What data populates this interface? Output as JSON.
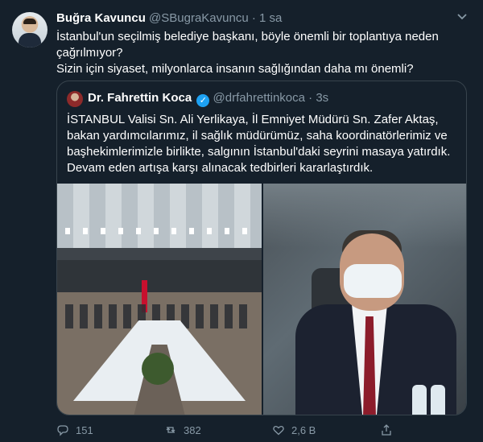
{
  "tweet": {
    "author_name": "Buğra Kavuncu",
    "handle": "@SBugraKavuncu",
    "separator": "·",
    "time": "1 sa",
    "text_line1": "İstanbul'un seçilmiş belediye başkanı, böyle önemli bir toplantıya neden çağrılmıyor?",
    "text_line2": "Sizin için siyaset, milyonlarca insanın sağlığından daha mı önemli?",
    "stats": {
      "replies": "151",
      "retweets": "382",
      "likes": "2,6 B"
    }
  },
  "quoted": {
    "author_name": "Dr. Fahrettin Koca",
    "verified_mark": "✓",
    "handle": "@drfahrettinkoca",
    "separator": "·",
    "time": "3s",
    "text": "İSTANBUL Valisi Sn. Ali Yerlikaya, İl Emniyet Müdürü Sn. Zafer Aktaş, bakan yardımcılarımız, il sağlık müdürümüz, saha koordinatörlerimiz ve başhekimlerimizle birlikte, salgının İstanbul'daki seyrini masaya yatırdık. Devam eden artışa karşı alınacak tedbirleri kararlaştırdık."
  },
  "icons": [
    "chevron-down-icon",
    "reply-icon",
    "retweet-icon",
    "like-icon",
    "share-icon",
    "verified-icon"
  ],
  "colors": {
    "background": "#15202b",
    "muted": "#8899a6",
    "border": "#38444d",
    "verified": "#1da1f2"
  }
}
